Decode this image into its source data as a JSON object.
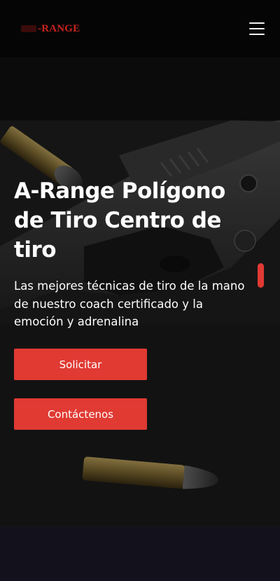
{
  "header": {
    "logo_text": "-RANGE",
    "menu_icon": "hamburger-menu-icon"
  },
  "hero": {
    "title": "A-Range Polígono de Tiro Centro de tiro",
    "subtitle": "Las mejores técnicas de tiro de la mano de nuestro coach certificado y la emoción y adrenalina",
    "buttons": {
      "request_label": "Solicitar",
      "contact_label": "Contáctenos"
    }
  },
  "colors": {
    "accent": "#e03a33",
    "logo": "#c8231e",
    "header_bg": "#050505",
    "footer_bg": "#13121c"
  }
}
